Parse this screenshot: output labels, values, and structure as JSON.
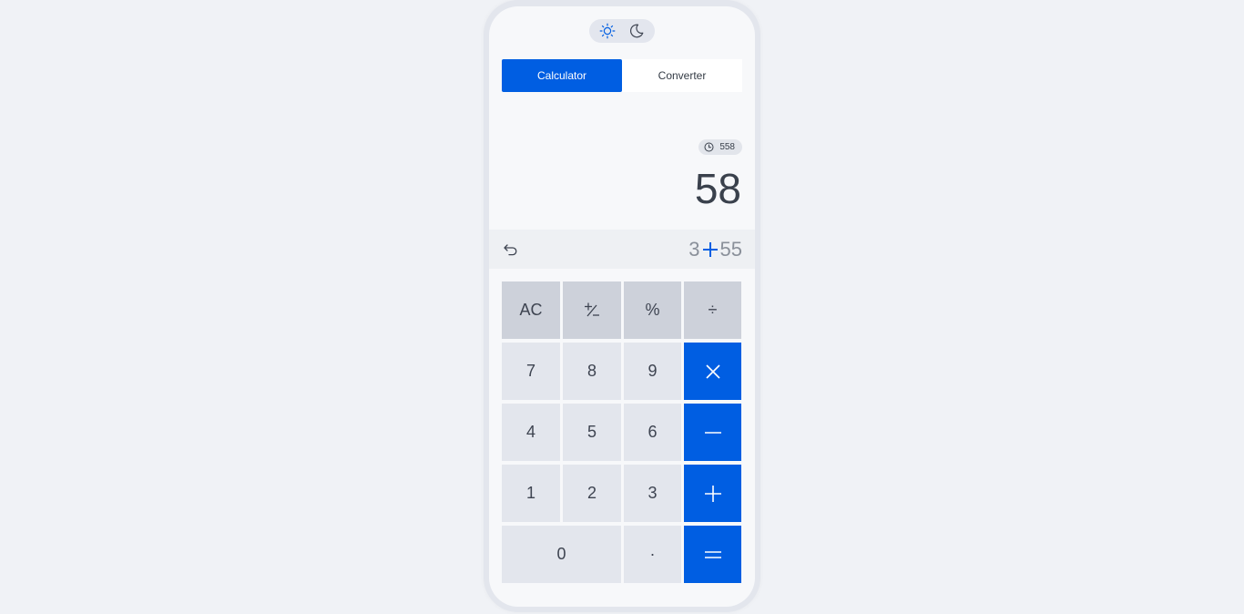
{
  "theme_toggle": {
    "light_icon": "sun-icon",
    "dark_icon": "moon-icon",
    "selected": "light"
  },
  "tabs": [
    {
      "label": "Calculator",
      "active": true
    },
    {
      "label": "Converter",
      "active": false
    }
  ],
  "history": {
    "icon": "clock-icon",
    "value": "558"
  },
  "display": {
    "result": "58",
    "expression": {
      "left": "3",
      "operator": "+",
      "right": "55"
    },
    "undo_icon": "undo-icon"
  },
  "keypad": {
    "ac": "AC",
    "plus_minus": "+/−",
    "percent": "%",
    "divide": "÷",
    "seven": "7",
    "eight": "8",
    "nine": "9",
    "multiply": "×",
    "four": "4",
    "five": "5",
    "six": "6",
    "minus": "−",
    "one": "1",
    "two": "2",
    "three": "3",
    "plus": "+",
    "zero": "0",
    "decimal": "·",
    "equals": "="
  },
  "colors": {
    "accent": "#005ee2",
    "background": "#f0f2f6",
    "key": "#e3e6ed",
    "function_key": "#cdd1da",
    "text": "#3a414c"
  }
}
